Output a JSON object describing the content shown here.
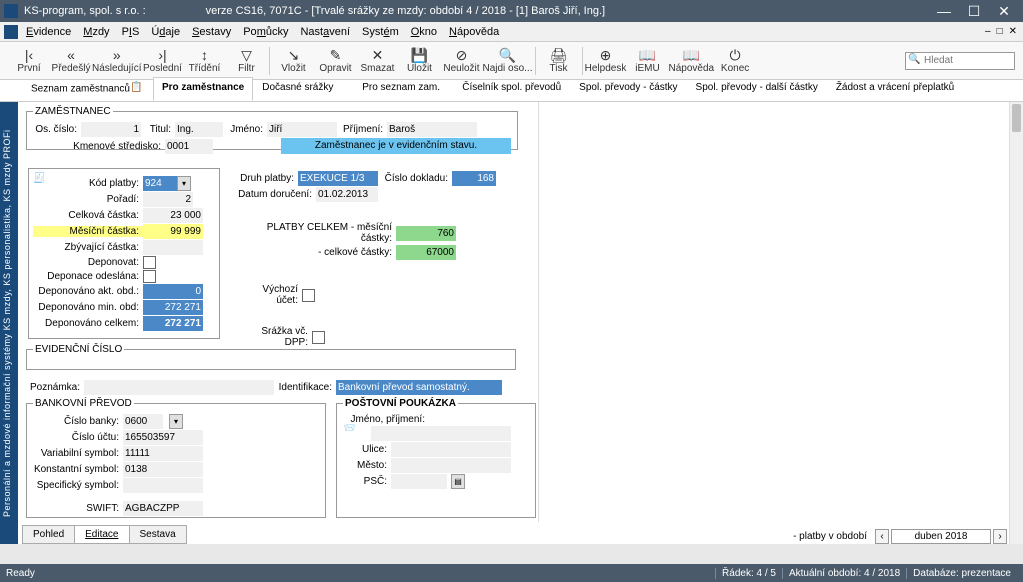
{
  "title": {
    "app": "KS-program, spol. s r.o. :",
    "ver": "verze CS16, 7071C - [Trvalé srážky ze mzdy: období 4 / 2018 - [1] Baroš Jiří, Ing.]"
  },
  "menu": [
    "Evidence",
    "Mzdy",
    "PIS",
    "Údaje",
    "Sestavy",
    "Pomůcky",
    "Nastavení",
    "Systém",
    "Okno",
    "Nápověda"
  ],
  "mdi_icons": [
    "–",
    "□",
    "✕"
  ],
  "toolbar": [
    {
      "icon": "|‹",
      "label": "První"
    },
    {
      "icon": "«",
      "label": "Předešlý"
    },
    {
      "icon": "»",
      "label": "Následující"
    },
    {
      "icon": "›|",
      "label": "Poslední"
    },
    {
      "icon": "↕",
      "label": "Třídění"
    },
    {
      "icon": "▽",
      "label": "Filtr"
    },
    {
      "sep": true
    },
    {
      "icon": "↘",
      "label": "Vložit"
    },
    {
      "icon": "✎",
      "label": "Opravit"
    },
    {
      "icon": "✕",
      "label": "Smazat"
    },
    {
      "icon": "💾",
      "label": "Uložit"
    },
    {
      "icon": "⊘",
      "label": "Neuložit"
    },
    {
      "icon": "🔍",
      "label": "Najdi oso..."
    },
    {
      "sep": true
    },
    {
      "icon": "🖨",
      "label": "Tisk"
    },
    {
      "sep": true
    },
    {
      "icon": "⊕",
      "label": "Helpdesk"
    },
    {
      "icon": "📖",
      "label": "iEMU"
    },
    {
      "icon": "📖",
      "label": "Nápověda"
    },
    {
      "icon": "⏻",
      "label": "Konec"
    }
  ],
  "search_placeholder": "Hledat",
  "tabs": [
    "Seznam zaměstnanců",
    "Pro zaměstnance",
    "Dočasné srážky",
    "Pro seznam zam.",
    "Číselník spol. převodů",
    "Spol. převody - částky",
    "Spol. převody - další částky",
    "Žádost a vrácení přeplatků"
  ],
  "side_text": "Personální a mzdové informační systémy KS mzdy, KS personalistika, KS mzdy PROFi",
  "emp": {
    "legend": "ZAMĚSTNANEC",
    "os_cislo_l": "Os. číslo:",
    "os_cislo_v": "1",
    "titul_l": "Titul:",
    "titul_v": "Ing.",
    "jmeno_l": "Jméno:",
    "jmeno_v": "Jiří",
    "prijmeni_l": "Příjmení:",
    "prijmeni_v": "Baroš",
    "stred_l": "Kmenové středisko:",
    "stred_v": "0001",
    "banner": "Zaměstnanec je v evidenčním stavu."
  },
  "platba": {
    "kod_l": "Kód platby:",
    "kod_v": "924",
    "poradi_l": "Pořadí:",
    "poradi_v": "2",
    "celkova_l": "Celková částka:",
    "celkova_v": "23 000",
    "mesicni_l": "Měsíční částka:",
    "mesicni_v": "99 999",
    "zbyv_l": "Zbývající částka:",
    "depon_l": "Deponovat:",
    "dep_odesl_l": "Deponace odeslána:",
    "dep_akt_l": "Deponováno akt. obd.:",
    "dep_akt_v": "0",
    "dep_min_l": "Deponováno min. obd:",
    "dep_min_v": "272 271",
    "dep_cel_l": "Deponováno celkem:",
    "dep_cel_v": "272 271",
    "druh_l": "Druh platby:",
    "druh_v": "EXEKUCE 1/3",
    "datum_l": "Datum doručení:",
    "datum_v": "01.02.2013",
    "cdokl_l": "Číslo dokladu:",
    "cdokl_v": "168",
    "pc_l": "PLATBY CELKEM - měsíční částky:",
    "pc_v": "760",
    "pc2_l": "- celkové částky:",
    "pc2_v": "67000",
    "vych_l": "Výchozí účet:",
    "dpp_l": "Srážka vč. DPP:"
  },
  "evid_legend": "EVIDENČNÍ ČÍSLO",
  "pozn_l": "Poznámka:",
  "ident_l": "Identifikace:",
  "ident_v": "Bankovní převod samostatný.",
  "bank": {
    "legend": "BANKOVNÍ PŘEVOD",
    "cb_l": "Číslo banky:",
    "cb_v": "0600",
    "cu_l": "Číslo účtu:",
    "cu_v": "165503597",
    "vs_l": "Variabilní symbol:",
    "vs_v": "11111",
    "ks_l": "Konstantní symbol:",
    "ks_v": "0138",
    "ss_l": "Specifický symbol:",
    "sw_l": "SWIFT:",
    "sw_v": "AGBACZPP"
  },
  "post": {
    "legend": "POŠTOVNÍ POUKÁZKA",
    "jm_l": "Jméno, příjmení:",
    "ul_l": "Ulice:",
    "me_l": "Město:",
    "psc_l": "PSČ:"
  },
  "subtabs": [
    "Pohled",
    "Editace",
    "Sestava"
  ],
  "pager": {
    "text": "- platby v období",
    "value": "duben 2018"
  },
  "status": {
    "ready": "Ready",
    "radek": "Řádek: 4 / 5",
    "obdobi": "Aktuální období: 4 / 2018",
    "db": "Databáze: prezentace"
  }
}
